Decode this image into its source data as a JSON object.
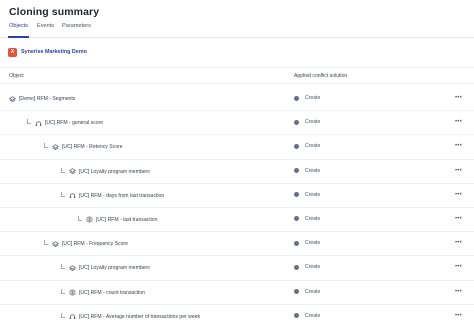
{
  "title": "Cloning summary",
  "tabs": [
    {
      "label": "Objects",
      "active": true
    },
    {
      "label": "Events",
      "active": false
    },
    {
      "label": "Parameters",
      "active": false
    }
  ],
  "workspace": {
    "badge": "X",
    "name": "Synerise Marketing Demo",
    "badge_color": "#e8503a"
  },
  "table": {
    "columns": [
      "Object",
      "Applied conflict solution"
    ],
    "rows": [
      {
        "depth": 0,
        "icon": "segment-icon",
        "label": "[Demo] RFM - Segments",
        "solution": "Create"
      },
      {
        "depth": 1,
        "icon": "metric-icon",
        "label": "[UC] RFM - general score",
        "solution": "Create"
      },
      {
        "depth": 2,
        "icon": "segment-icon",
        "label": "[UC] RFM - Retency Score",
        "solution": "Create"
      },
      {
        "depth": 3,
        "icon": "segment-icon",
        "label": "[UC] Loyalty program members",
        "solution": "Create"
      },
      {
        "depth": 3,
        "icon": "metric-icon",
        "label": "[UC] RFM - days from last transaction",
        "solution": "Create"
      },
      {
        "depth": 4,
        "icon": "aggregate-icon",
        "label": "[UC] RFM - last transaction",
        "solution": "Create"
      },
      {
        "depth": 2,
        "icon": "segment-icon",
        "label": "[UC] RFM - Frequency Score",
        "solution": "Create"
      },
      {
        "depth": 3,
        "icon": "segment-icon",
        "label": "[UC] Loyalty program members",
        "solution": "Create"
      },
      {
        "depth": 3,
        "icon": "aggregate-icon",
        "label": "[UC] RFM - count transaction",
        "solution": "Create"
      },
      {
        "depth": 3,
        "icon": "metric-icon",
        "label": "[UC] RFM - Average number of transactions per week",
        "solution": "Create"
      }
    ]
  },
  "row_menu_glyph": "•••",
  "colors": {
    "accent": "#2c3fa8",
    "status_dot": "#6b7080"
  }
}
